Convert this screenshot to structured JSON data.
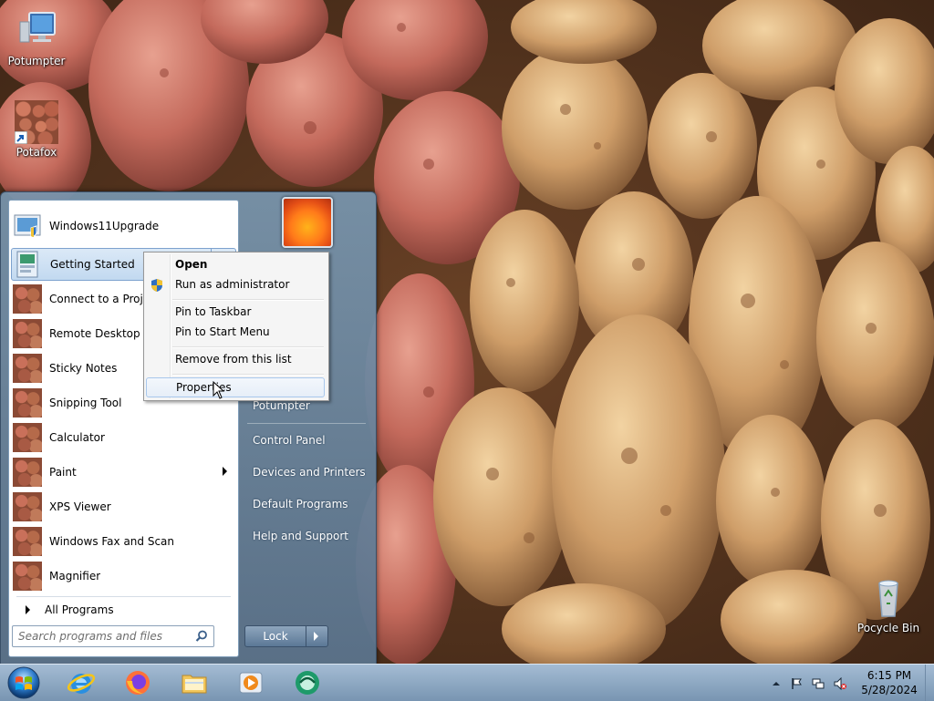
{
  "desktop": {
    "icons": [
      {
        "label": "Potumpter",
        "icon": "computer-icon"
      },
      {
        "label": "Potafox",
        "icon": "shortcut-icon"
      },
      {
        "label": "Pocycle Bin",
        "icon": "recycle-bin-icon"
      }
    ]
  },
  "start_menu": {
    "programs": [
      {
        "label": "Windows11Upgrade",
        "icon": "upgrade-icon"
      },
      {
        "label": "Getting Started",
        "icon": "getting-started-icon"
      },
      {
        "label": "Connect to a Projector",
        "icon": "potato-icon"
      },
      {
        "label": "Remote Desktop Connection",
        "icon": "potato-icon"
      },
      {
        "label": "Sticky Notes",
        "icon": "potato-icon"
      },
      {
        "label": "Snipping Tool",
        "icon": "potato-icon"
      },
      {
        "label": "Calculator",
        "icon": "potato-icon"
      },
      {
        "label": "Paint",
        "icon": "potato-icon"
      },
      {
        "label": "XPS Viewer",
        "icon": "potato-icon"
      },
      {
        "label": "Windows Fax and Scan",
        "icon": "potato-icon"
      },
      {
        "label": "Magnifier",
        "icon": "potato-icon"
      }
    ],
    "all_programs": "All Programs",
    "search_placeholder": "Search programs and files",
    "right_links": [
      "Potumpter",
      "Control Panel",
      "Devices and Printers",
      "Default Programs",
      "Help and Support"
    ],
    "lock_label": "Lock"
  },
  "context_menu": {
    "items": [
      "Open",
      "Run as administrator",
      "Pin to Taskbar",
      "Pin to Start Menu",
      "Remove from this list",
      "Properties"
    ]
  },
  "taskbar": {
    "pinned": [
      "internet-explorer-icon",
      "firefox-icon",
      "file-explorer-icon",
      "media-player-icon",
      "app-icon"
    ],
    "time": "6:15 PM",
    "date": "5/28/2024"
  },
  "colors": {
    "taskbar": "#8fa9c4",
    "start_menu": "#6f8aa6",
    "highlight": "#c2d9f0"
  }
}
